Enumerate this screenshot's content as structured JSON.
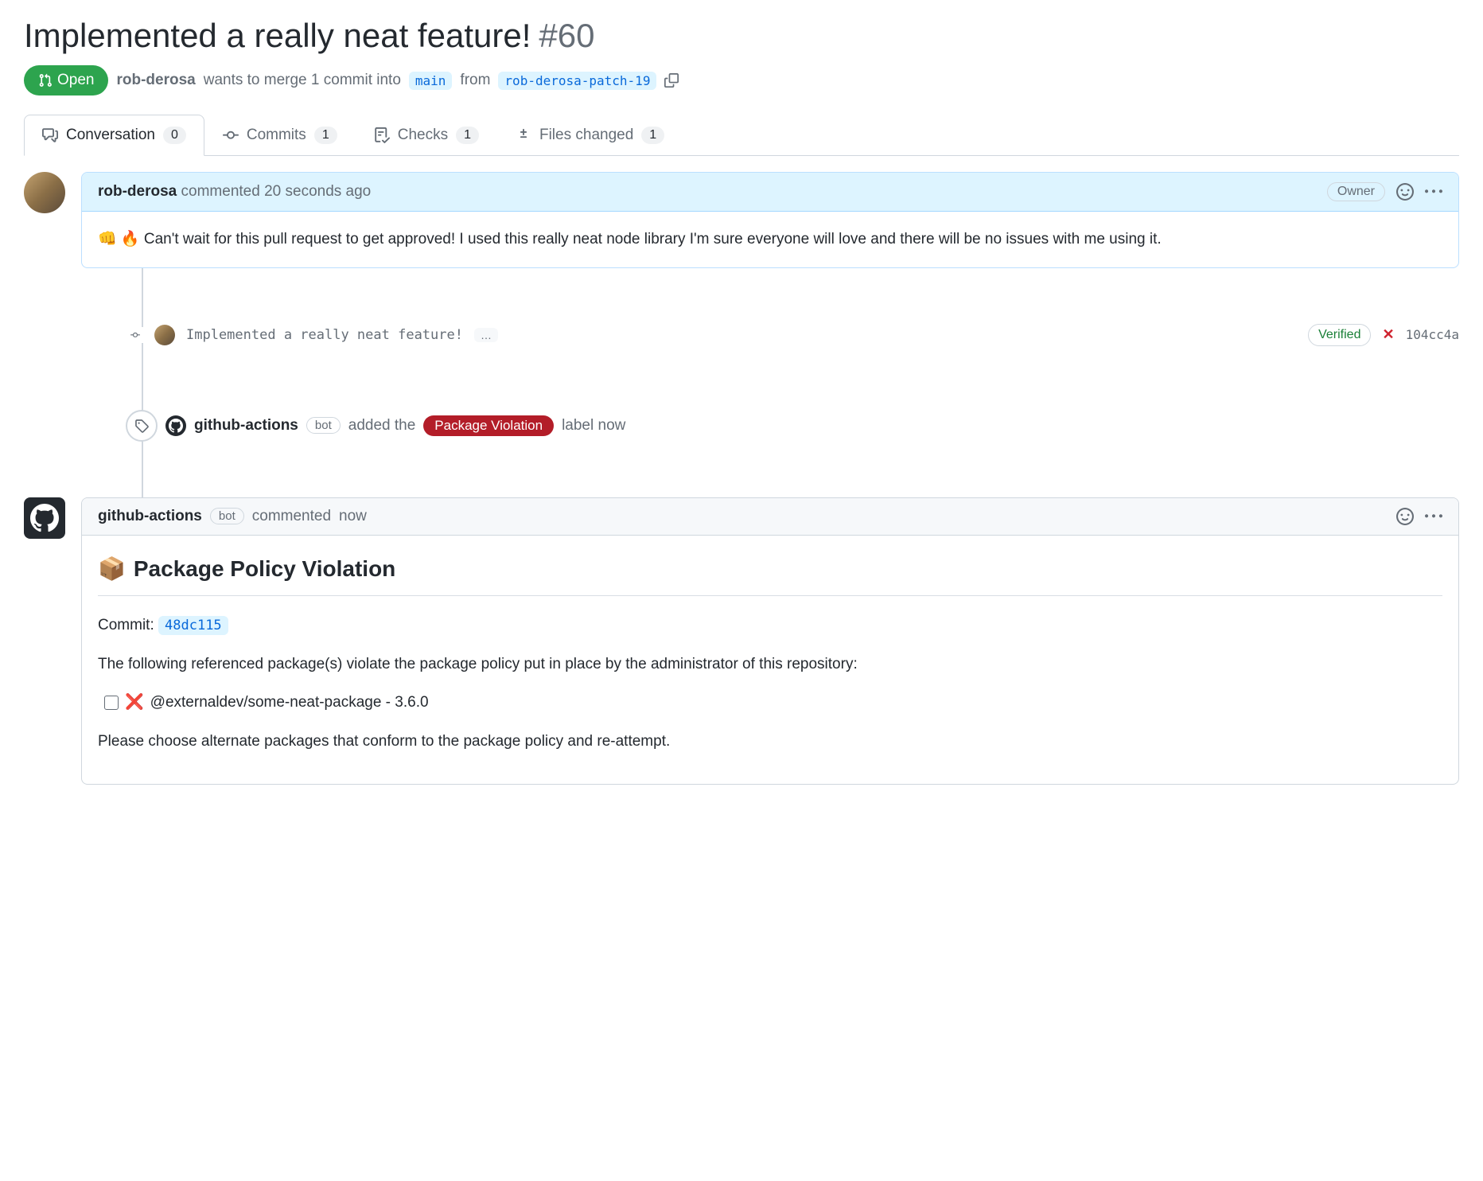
{
  "pr": {
    "title": "Implemented a really neat feature!",
    "number": "#60",
    "state": "Open",
    "author": "rob-derosa",
    "merge_text_1": "wants to merge 1 commit into",
    "base_branch": "main",
    "merge_text_2": "from",
    "head_branch": "rob-derosa-patch-19"
  },
  "tabs": {
    "conversation": {
      "label": "Conversation",
      "count": "0"
    },
    "commits": {
      "label": "Commits",
      "count": "1"
    },
    "checks": {
      "label": "Checks",
      "count": "1"
    },
    "files": {
      "label": "Files changed",
      "count": "1"
    }
  },
  "comment1": {
    "author": "rob-derosa",
    "verb": "commented",
    "time": "20 seconds ago",
    "badge": "Owner",
    "body": "👊 🔥 Can't wait for this pull request to get approved! I used this really neat node library I'm sure everyone will love and there will be no issues with me using it."
  },
  "commit": {
    "message": "Implemented a really neat feature!",
    "verified": "Verified",
    "sha": "104cc4a",
    "status_fail": "✕"
  },
  "label_event": {
    "actor": "github-actions",
    "bot": "bot",
    "text_before": "added the",
    "label": "Package Violation",
    "text_after": "label now"
  },
  "comment2": {
    "author": "github-actions",
    "bot": "bot",
    "verb": "commented",
    "time": "now",
    "title": "Package Policy Violation",
    "emoji": "📦",
    "commit_label": "Commit:",
    "commit_sha": "48dc115",
    "intro": "The following referenced package(s) violate the package policy put in place by the administrator of this repository:",
    "pkg": "@externaldev/some-neat-package - 3.6.0",
    "outro": "Please choose alternate packages that conform to the package policy and re-attempt."
  }
}
